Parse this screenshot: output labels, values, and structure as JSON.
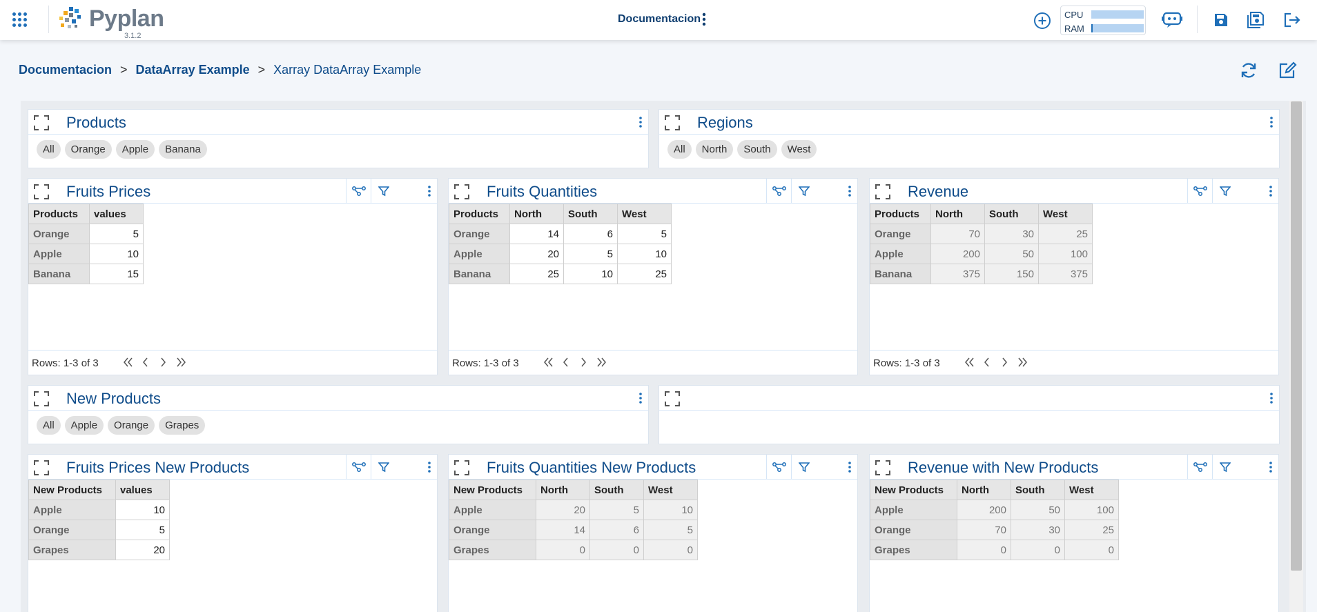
{
  "app": {
    "name": "Pyplan",
    "version": "3.1.2"
  },
  "header": {
    "document_title": "Documentacion",
    "cpu_label": "CPU",
    "ram_label": "RAM",
    "cpu_usage": 0.0,
    "ram_usage": 0.02,
    "accent": "#1f6fb8"
  },
  "breadcrumb": {
    "items": [
      "Documentacion",
      "DataArray Example",
      "Xarray DataArray Example"
    ],
    "separator": ">"
  },
  "selectors": [
    {
      "title": "Products",
      "options": [
        "All",
        "Orange",
        "Apple",
        "Banana"
      ]
    },
    {
      "title": "Regions",
      "options": [
        "All",
        "North",
        "South",
        "West"
      ]
    },
    {
      "title": "New Products",
      "options": [
        "All",
        "Apple",
        "Orange",
        "Grapes"
      ]
    },
    {
      "title": ""
    }
  ],
  "tables": [
    {
      "title": "Fruits Prices",
      "columns": [
        "Products",
        "values"
      ],
      "rows": [
        {
          "label": "Orange",
          "values": [
            "5"
          ]
        },
        {
          "label": "Apple",
          "values": [
            "10"
          ]
        },
        {
          "label": "Banana",
          "values": [
            "15"
          ]
        }
      ],
      "footer": "Rows: 1-3 of 3"
    },
    {
      "title": "Fruits Quantities",
      "columns": [
        "Products",
        "North",
        "South",
        "West"
      ],
      "rows": [
        {
          "label": "Orange",
          "values": [
            "14",
            "6",
            "5"
          ]
        },
        {
          "label": "Apple",
          "values": [
            "20",
            "5",
            "10"
          ]
        },
        {
          "label": "Banana",
          "values": [
            "25",
            "10",
            "25"
          ]
        }
      ],
      "footer": "Rows: 1-3 of 3"
    },
    {
      "title": "Revenue",
      "columns": [
        "Products",
        "North",
        "South",
        "West"
      ],
      "rows": [
        {
          "label": "Orange",
          "values": [
            "70",
            "30",
            "25"
          ]
        },
        {
          "label": "Apple",
          "values": [
            "200",
            "50",
            "100"
          ]
        },
        {
          "label": "Banana",
          "values": [
            "375",
            "150",
            "375"
          ]
        }
      ],
      "footer": "Rows: 1-3 of 3"
    },
    {
      "title": "Fruits Prices New Products",
      "columns": [
        "New Products",
        "values"
      ],
      "rows": [
        {
          "label": "Apple",
          "values": [
            "10"
          ]
        },
        {
          "label": "Orange",
          "values": [
            "5"
          ]
        },
        {
          "label": "Grapes",
          "values": [
            "20"
          ]
        }
      ]
    },
    {
      "title": "Fruits Quantities New Products",
      "columns": [
        "New Products",
        "North",
        "South",
        "West"
      ],
      "rows": [
        {
          "label": "Apple",
          "values": [
            "20",
            "5",
            "10"
          ]
        },
        {
          "label": "Orange",
          "values": [
            "14",
            "6",
            "5"
          ]
        },
        {
          "label": "Grapes",
          "values": [
            "0",
            "0",
            "0"
          ]
        }
      ]
    },
    {
      "title": "Revenue with New Products",
      "columns": [
        "New Products",
        "North",
        "South",
        "West"
      ],
      "rows": [
        {
          "label": "Apple",
          "values": [
            "200",
            "50",
            "100"
          ]
        },
        {
          "label": "Orange",
          "values": [
            "70",
            "30",
            "25"
          ]
        },
        {
          "label": "Grapes",
          "values": [
            "0",
            "0",
            "0"
          ]
        }
      ]
    }
  ]
}
